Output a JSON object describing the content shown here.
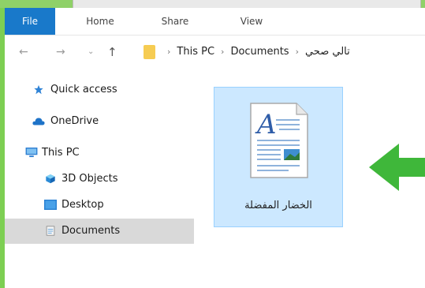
{
  "ribbon": {
    "tabs": [
      "File",
      "Home",
      "Share",
      "View"
    ]
  },
  "address": {
    "crumbs": [
      "This PC",
      "Documents",
      "تالي صحي"
    ],
    "separator": "›"
  },
  "sidebar": {
    "items": [
      {
        "label": "Quick access",
        "icon": "star-icon"
      },
      {
        "label": "OneDrive",
        "icon": "cloud-icon"
      },
      {
        "label": "This PC",
        "icon": "computer-icon"
      },
      {
        "label": "3D Objects",
        "icon": "cube-icon"
      },
      {
        "label": "Desktop",
        "icon": "desktop-icon"
      },
      {
        "label": "Documents",
        "icon": "documents-icon"
      }
    ]
  },
  "main": {
    "file": {
      "name": "الخضار المفضلة",
      "icon": "word-document-icon"
    }
  },
  "colors": {
    "accent": "#1979ca",
    "background_frame": "#7dcf53",
    "selection": "#cce8ff",
    "arrow": "#3fb73a"
  }
}
